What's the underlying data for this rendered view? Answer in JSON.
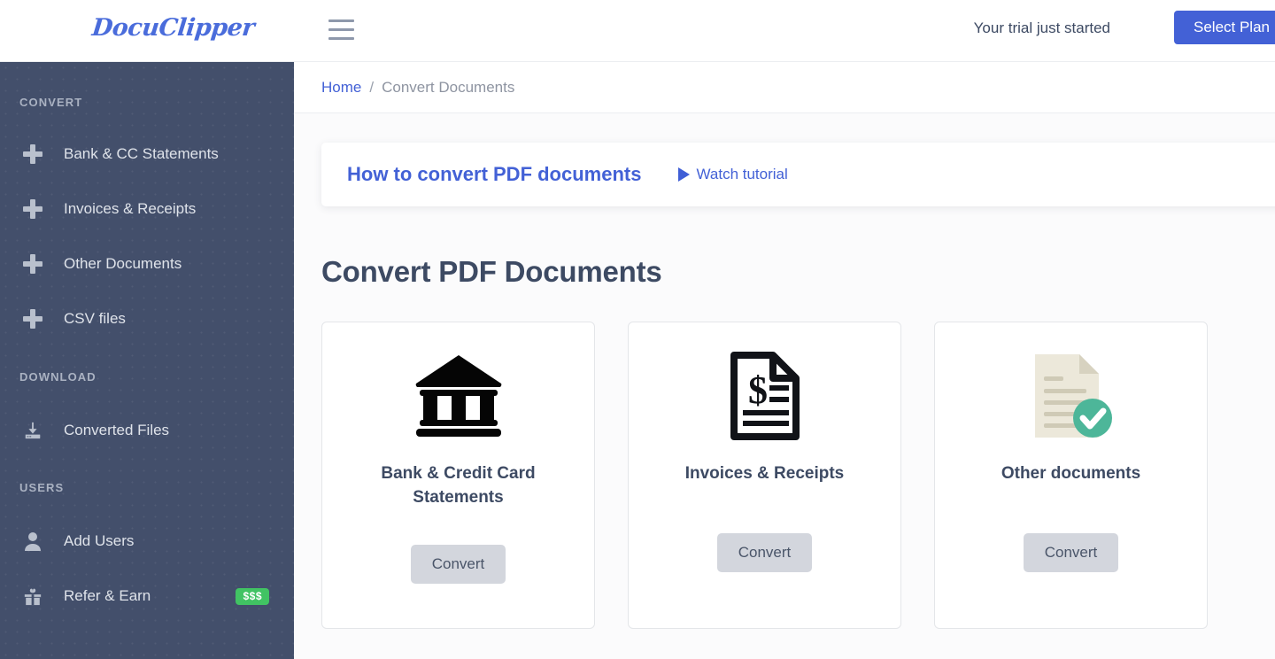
{
  "header": {
    "logo_text": "DocuClipper",
    "menu_icon": "hamburger-icon",
    "trial_text": "Your trial just started",
    "select_plan_label": "Select Plan",
    "brand_color": "#4a6cdb",
    "accent_color": "#4361d6"
  },
  "sidebar": {
    "background_color": "#434f6b",
    "sections": [
      {
        "title": "CONVERT",
        "items": [
          {
            "label": "Bank & CC Statements",
            "icon": "plus-icon"
          },
          {
            "label": "Invoices & Receipts",
            "icon": "plus-icon"
          },
          {
            "label": "Other Documents",
            "icon": "plus-icon"
          },
          {
            "label": "CSV files",
            "icon": "plus-icon"
          }
        ]
      },
      {
        "title": "DOWNLOAD",
        "items": [
          {
            "label": "Converted Files",
            "icon": "download-icon"
          }
        ]
      },
      {
        "title": "USERS",
        "items": [
          {
            "label": "Add Users",
            "icon": "user-icon"
          },
          {
            "label": "Refer & Earn",
            "icon": "gift-icon",
            "badge": "$$$",
            "badge_color": "#41c363"
          }
        ]
      }
    ]
  },
  "breadcrumb": {
    "home": "Home",
    "separator": "/",
    "current": "Convert Documents"
  },
  "tutorial_banner": {
    "title": "How to convert PDF documents",
    "watch_label": "Watch tutorial",
    "play_icon": "play-icon"
  },
  "main": {
    "page_title": "Convert PDF Documents",
    "cards": [
      {
        "title": "Bank & Credit Card Statements",
        "icon": "bank-icon",
        "button_label": "Convert"
      },
      {
        "title": "Invoices & Receipts",
        "icon": "invoice-document-icon",
        "button_label": "Convert"
      },
      {
        "title": "Other documents",
        "icon": "document-check-icon",
        "button_label": "Convert",
        "badge_icon": "green-check-badge",
        "badge_color": "#4db699"
      }
    ]
  }
}
